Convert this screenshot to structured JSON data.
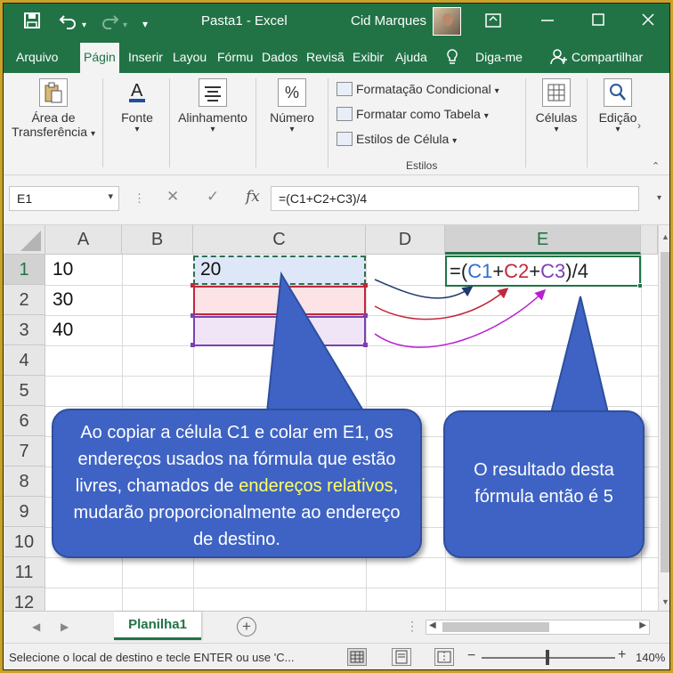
{
  "titlebar": {
    "title": "Pasta1 - Excel",
    "user": "Cid Marques"
  },
  "tabs": [
    {
      "label": "Arquivo"
    },
    {
      "label": "Págin"
    },
    {
      "label": "Inserir"
    },
    {
      "label": "Layou"
    },
    {
      "label": "Fórmu"
    },
    {
      "label": "Dados"
    },
    {
      "label": "Revisã"
    },
    {
      "label": "Exibir"
    },
    {
      "label": "Ajuda"
    },
    {
      "label": "Diga-me"
    },
    {
      "label": "Compartilhar"
    }
  ],
  "ribbon": {
    "clipboard": {
      "line1": "Área de",
      "line2": "Transferência"
    },
    "font": "Fonte",
    "alignment": "Alinhamento",
    "number": "Número",
    "number_icon": "%",
    "cond_format": "Formatação Condicional",
    "format_table": "Formatar como Tabela",
    "cell_styles": "Estilos de Célula",
    "styles_group": "Estilos",
    "cells": "Células",
    "editing": "Edição"
  },
  "formula_bar": {
    "name_box": "E1",
    "formula": "=(C1+C2+C3)/4"
  },
  "grid": {
    "columns": [
      "A",
      "B",
      "C",
      "D",
      "E"
    ],
    "rows": [
      "1",
      "2",
      "3",
      "4",
      "5",
      "6",
      "7",
      "8",
      "9",
      "10",
      "11",
      "12"
    ],
    "cells": {
      "A1": "10",
      "A2": "30",
      "A3": "40",
      "C1": "20"
    },
    "e1_formula_parts": {
      "open": "=(",
      "c1": "C1",
      "plus1": "+",
      "c2": "C2",
      "plus2": "+",
      "c3": "C3",
      "close": ")/4"
    }
  },
  "callouts": {
    "left_before": "Ao copiar a célula C1 e colar em E1, os endereços usados na fórmula que estão livres, chamados de ",
    "left_highlight": "endereços relativos",
    "left_after": ", mudarão proporcionalmente ao endereço de destino.",
    "right": "O resultado desta fórmula então é 5"
  },
  "sheet": {
    "tab": "Planilha1"
  },
  "status": {
    "message": "Selecione o local de destino e tecle ENTER ou use 'C...",
    "zoom": "140%"
  },
  "colors": {
    "excel_green": "#217346",
    "ref_c1": "#2f6fd1",
    "ref_c2": "#c0283c",
    "ref_c3": "#7b3fb3",
    "callout_fill": "#3f63c4",
    "highlight": "#ffff66"
  }
}
